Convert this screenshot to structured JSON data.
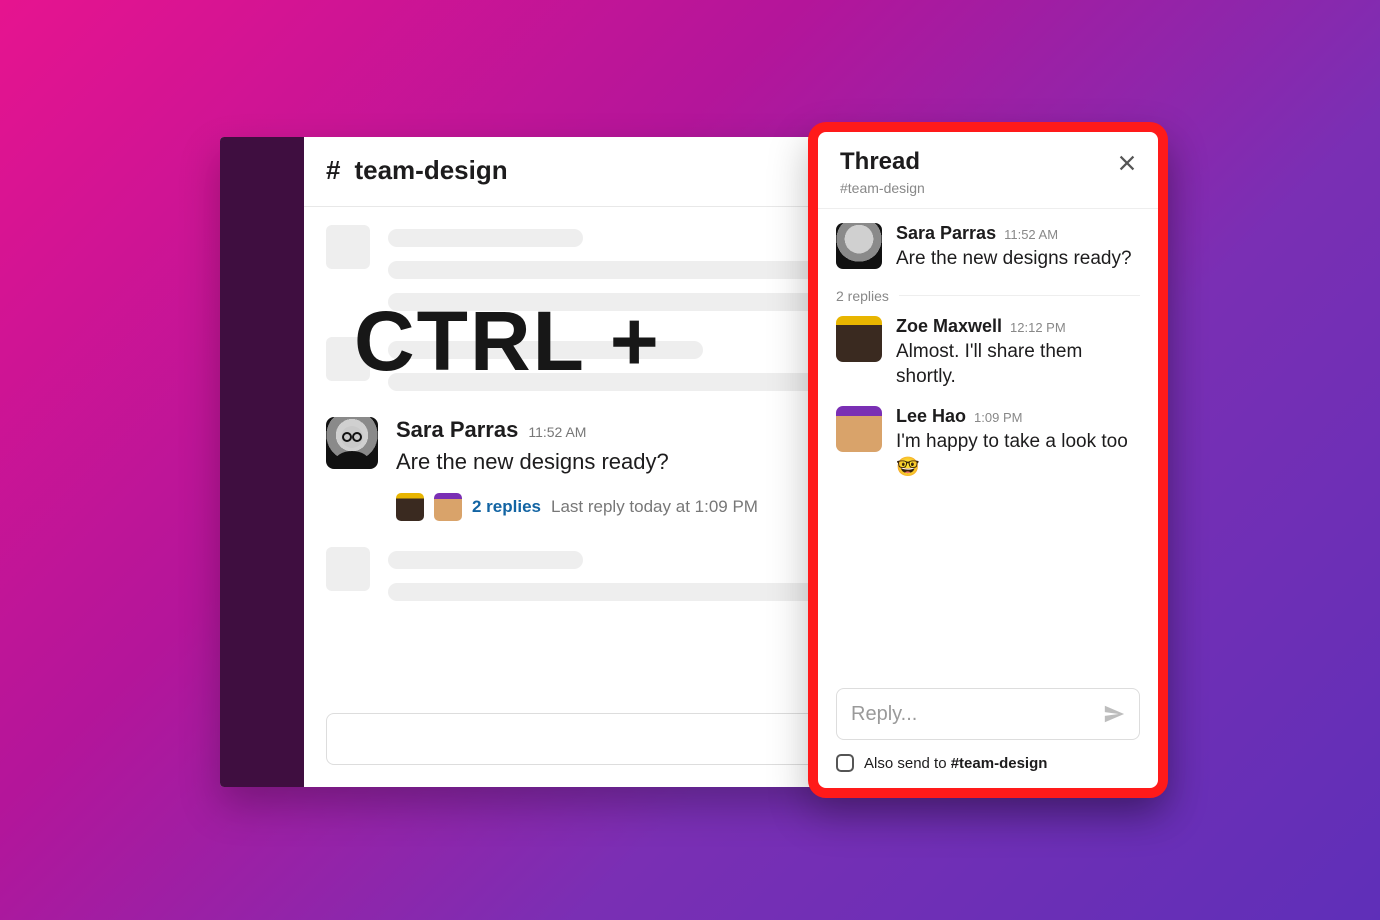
{
  "channel": {
    "hash": "#",
    "name": "team-design"
  },
  "overlay": "CTRL +",
  "main_message": {
    "author": "Sara Parras",
    "time": "11:52 AM",
    "text": "Are the new designs ready?",
    "replies_link": "2 replies",
    "last_reply": "Last reply today at 1:09 PM"
  },
  "thread": {
    "title": "Thread",
    "subtitle": "#team-design",
    "reply_count_label": "2 replies",
    "messages": [
      {
        "author": "Sara Parras",
        "time": "11:52 AM",
        "text": "Are the new designs ready?"
      },
      {
        "author": "Zoe Maxwell",
        "time": "12:12 PM",
        "text": "Almost. I'll share them shortly."
      },
      {
        "author": "Lee Hao",
        "time": "1:09 PM",
        "text": "I'm happy to take a look too 🤓"
      }
    ],
    "composer_placeholder": "Reply...",
    "also_send_prefix": "Also send to ",
    "also_send_channel": "#team-design"
  }
}
